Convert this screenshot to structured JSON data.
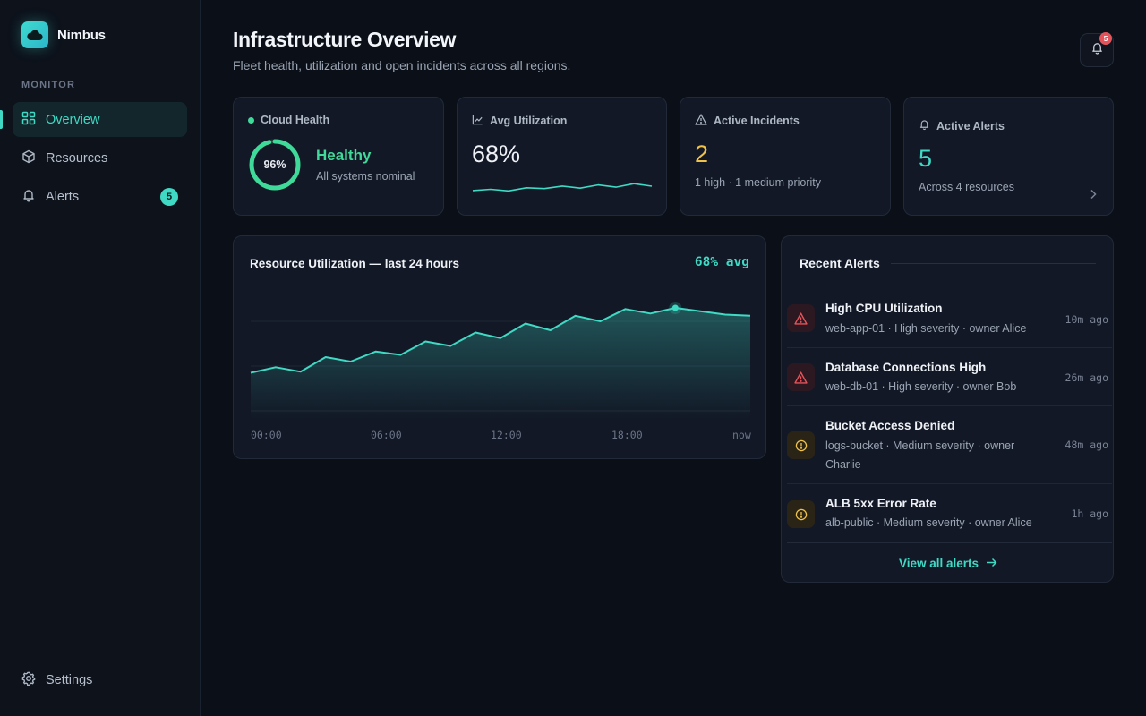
{
  "app": {
    "name": "Nimbus"
  },
  "colors": {
    "accent": "#3fd9c4",
    "healthy": "#3fd99a",
    "warning": "#f0c24a",
    "danger": "#e5535a"
  },
  "sidebar": {
    "section_label": "MONITOR",
    "items": [
      {
        "label": "Overview",
        "icon": "grid-icon",
        "active": true
      },
      {
        "label": "Resources",
        "icon": "cube-icon"
      },
      {
        "label": "Alerts",
        "icon": "bell-icon",
        "badge": "5"
      }
    ],
    "settings_label": "Settings"
  },
  "header": {
    "title": "Infrastructure Overview",
    "subtitle": "Fleet health, utilization and open incidents across all regions.",
    "notification_count": "5"
  },
  "stats": {
    "health": {
      "label": "Cloud Health",
      "score_text": "96%",
      "score": 0.96,
      "status": "Healthy",
      "note": "All systems nominal"
    },
    "utilization": {
      "label": "Avg Utilization",
      "value": "68%",
      "trend": [
        0.45,
        0.53,
        0.43,
        0.62,
        0.57,
        0.73,
        0.6,
        0.8,
        0.66,
        0.88,
        0.72
      ]
    },
    "incidents": {
      "label": "Active Incidents",
      "value": "2",
      "detail": "1 high · 1 medium priority"
    },
    "alerts": {
      "label": "Active Alerts",
      "value": "5",
      "detail": "Across 4 resources"
    }
  },
  "utilization_chart": {
    "title": "Resource Utilization — last 24 hours",
    "avg_label": "68% avg",
    "x_ticks": [
      "00:00",
      "06:00",
      "12:00",
      "18:00",
      "now"
    ]
  },
  "chart_data": {
    "type": "area",
    "title": "Resource Utilization — last 24 hours",
    "xlabel": "",
    "ylabel": "",
    "categories": [
      "00:00",
      "",
      "",
      "",
      "",
      "06:00",
      "",
      "",
      "",
      "",
      "12:00",
      "",
      "",
      "",
      "",
      "18:00",
      "",
      "",
      "",
      "",
      "now"
    ],
    "values": [
      42,
      47,
      43,
      56,
      52,
      61,
      58,
      70,
      66,
      78,
      73,
      86,
      80,
      93,
      88,
      99,
      95,
      100,
      97,
      94,
      93
    ],
    "series": [
      {
        "values": [
          42,
          47,
          43,
          56,
          52,
          61,
          58,
          70,
          66,
          78,
          73,
          86,
          80,
          93,
          88,
          99,
          95,
          100,
          97,
          94,
          93
        ]
      }
    ],
    "ylim": [
      0,
      120
    ],
    "grid": true
  },
  "recent_alerts": {
    "title": "Recent Alerts",
    "items": [
      {
        "title": "High CPU Utilization",
        "meta": "web-app-01 · High severity · owner Alice",
        "time": "10m ago",
        "severity": "high"
      },
      {
        "title": "Database Connections High",
        "meta": "web-db-01 · High severity · owner Bob",
        "time": "26m ago",
        "severity": "high"
      },
      {
        "title": "Bucket Access Denied",
        "meta": "logs-bucket · Medium severity · owner Charlie",
        "time": "48m ago",
        "severity": "medium"
      },
      {
        "title": "ALB 5xx Error Rate",
        "meta": "alb-public · Medium severity · owner Alice",
        "time": "1h ago",
        "severity": "medium"
      }
    ],
    "view_all_label": "View all alerts"
  }
}
